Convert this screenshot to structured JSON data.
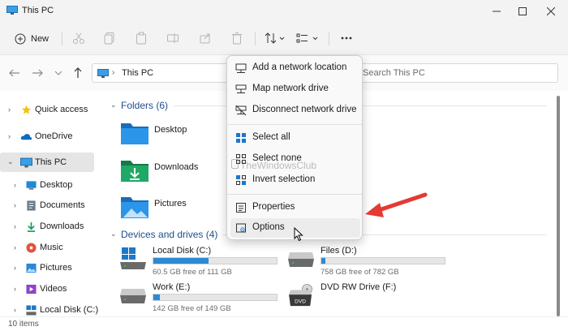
{
  "window": {
    "title": "This PC"
  },
  "toolbar": {
    "new_label": "New"
  },
  "address": {
    "path": "This PC",
    "search_placeholder": "Search This PC"
  },
  "sidebar": {
    "items": [
      {
        "label": "Quick access",
        "icon": "star-icon"
      },
      {
        "label": "OneDrive",
        "icon": "cloud-icon"
      },
      {
        "label": "This PC",
        "icon": "computer-icon"
      },
      {
        "label": "Desktop",
        "icon": "desktop-folder-icon"
      },
      {
        "label": "Documents",
        "icon": "documents-folder-icon"
      },
      {
        "label": "Downloads",
        "icon": "downloads-folder-icon"
      },
      {
        "label": "Music",
        "icon": "music-folder-icon"
      },
      {
        "label": "Pictures",
        "icon": "pictures-folder-icon"
      },
      {
        "label": "Videos",
        "icon": "videos-folder-icon"
      },
      {
        "label": "Local Disk (C:)",
        "icon": "drive-icon"
      }
    ]
  },
  "main": {
    "folders_header": "Folders (6)",
    "folders": [
      {
        "label": "Desktop"
      },
      {
        "label": "Downloads"
      },
      {
        "label": "Pictures"
      }
    ],
    "drives_header": "Devices and drives (4)",
    "drives": [
      {
        "name": "Local Disk (C:)",
        "free": "60.5 GB free of 111 GB",
        "used_fraction": 0.45
      },
      {
        "name": "Files (D:)",
        "free": "758 GB free of 782 GB",
        "used_fraction": 0.03
      },
      {
        "name": "Work (E:)",
        "free": "142 GB free of 149 GB",
        "used_fraction": 0.05
      },
      {
        "name": "DVD RW Drive (F:)",
        "free": "",
        "badge": "DVD"
      }
    ]
  },
  "menu": {
    "items": [
      {
        "label": "Add a network location",
        "icon": "network-location-icon"
      },
      {
        "label": "Map network drive",
        "icon": "map-drive-icon"
      },
      {
        "label": "Disconnect network drive",
        "icon": "disconnect-drive-icon"
      },
      {
        "label": "Select all",
        "icon": "select-all-icon"
      },
      {
        "label": "Select none",
        "icon": "select-none-icon"
      },
      {
        "label": "Invert selection",
        "icon": "invert-selection-icon"
      },
      {
        "label": "Properties",
        "icon": "properties-icon"
      },
      {
        "label": "Options",
        "icon": "options-icon"
      }
    ]
  },
  "watermark": "TheWindowsClub",
  "status": {
    "items_count": "10 items"
  },
  "colors": {
    "accent": "#2b8ad6",
    "folder_blue": "#1e78c8",
    "downloads_green": "#1a9a5c",
    "arrow_red": "#e53935"
  }
}
